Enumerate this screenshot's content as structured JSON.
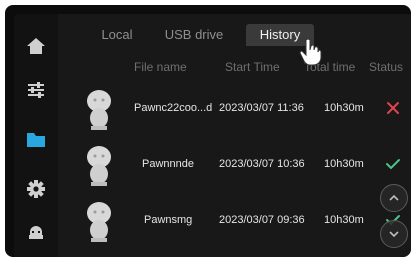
{
  "tabs": [
    {
      "label": "Local"
    },
    {
      "label": "USB drive"
    },
    {
      "label": "History"
    }
  ],
  "columns": {
    "file_name": "File name",
    "start_time": "Start Time",
    "total_time": "Total time",
    "status": "Status"
  },
  "rows": [
    {
      "file_name": "Pawnc22coo...d",
      "start_time": "2023/03/07 11:36",
      "total_time": "10h30m",
      "status": "failed"
    },
    {
      "file_name": "Pawnnnde",
      "start_time": "2023/03/07 10:36",
      "total_time": "10h30m",
      "status": "completed"
    },
    {
      "file_name": "Pawnsmg",
      "start_time": "2023/03/07 09:36",
      "total_time": "10h30m",
      "status": "completed"
    }
  ],
  "sidebar": {
    "items": [
      {
        "icon": "home-icon",
        "active": false
      },
      {
        "icon": "sliders-icon",
        "active": false
      },
      {
        "icon": "folder-icon",
        "active": true
      },
      {
        "icon": "gear-icon",
        "active": false
      },
      {
        "icon": "robot-icon",
        "active": false
      }
    ]
  },
  "colors": {
    "accent": "#29a8e0",
    "success": "#4cc38a",
    "error": "#e0454d"
  }
}
